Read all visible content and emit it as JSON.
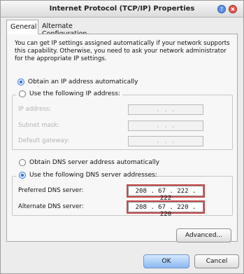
{
  "window": {
    "title": "Internet Protocol (TCP/IP) Properties"
  },
  "tabs": [
    {
      "label": "General"
    },
    {
      "label": "Alternate Configuration"
    }
  ],
  "intro": "You can get IP settings assigned automatically if your network supports this capability. Otherwise, you need to ask your network administrator for the appropriate IP settings.",
  "ip": {
    "auto_label": "Obtain an IP address automatically",
    "manual_label": "Use the following IP address:",
    "address_label": "IP address:",
    "subnet_label": "Subnet mask:",
    "gateway_label": "Default gateway:",
    "empty_ip": ".     .     ."
  },
  "dns": {
    "auto_label": "Obtain DNS server address automatically",
    "manual_label": "Use the following DNS server addresses:",
    "preferred_label": "Preferred DNS server:",
    "preferred_value": "208 .  67 . 222 . 222",
    "alternate_label": "Alternate DNS server:",
    "alternate_value": "208 .  67 . 220 . 220"
  },
  "buttons": {
    "advanced": "Advanced...",
    "ok": "OK",
    "cancel": "Cancel"
  },
  "colors": {
    "selected_radio": "#2a6fd6",
    "highlight_outline": "#c94a4a",
    "ok_button": "#8ab8f0"
  }
}
